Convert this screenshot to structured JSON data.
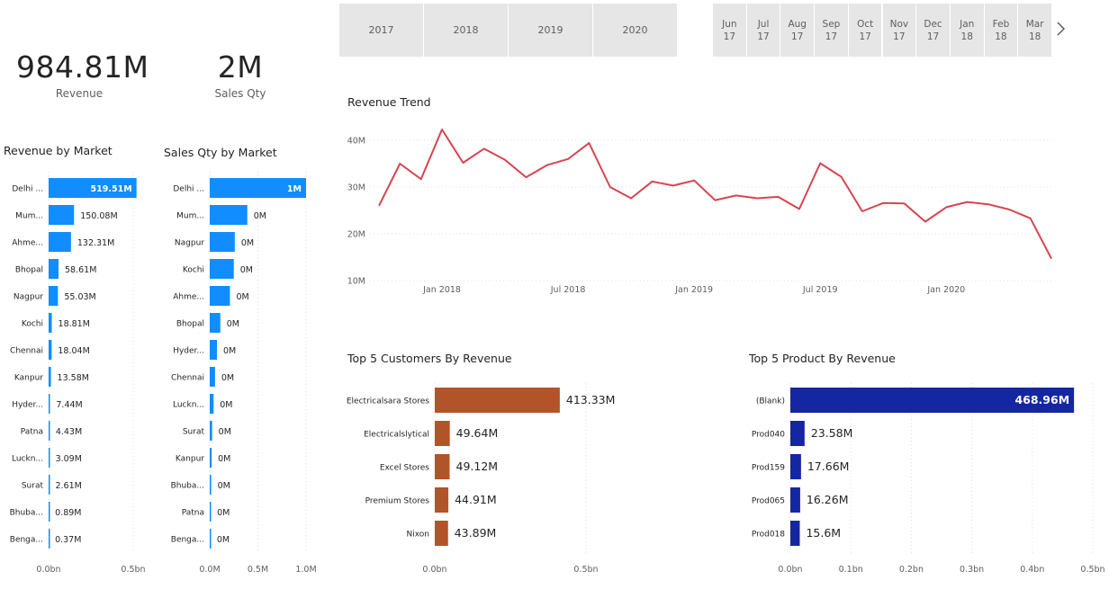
{
  "kpis": {
    "revenue": {
      "value": "984.81M",
      "label": "Revenue"
    },
    "sales_qty": {
      "value": "2M",
      "label": "Sales Qty"
    }
  },
  "year_slicer": [
    "2017",
    "2018",
    "2019",
    "2020"
  ],
  "month_slicer": [
    {
      "m": "Jun",
      "y": "17"
    },
    {
      "m": "Jul",
      "y": "17"
    },
    {
      "m": "Aug",
      "y": "17"
    },
    {
      "m": "Sep",
      "y": "17"
    },
    {
      "m": "Oct",
      "y": "17"
    },
    {
      "m": "Nov",
      "y": "17"
    },
    {
      "m": "Dec",
      "y": "17"
    },
    {
      "m": "Jan",
      "y": "18"
    },
    {
      "m": "Feb",
      "y": "18"
    },
    {
      "m": "Mar",
      "y": "18"
    }
  ],
  "colors": {
    "market_bar": "#118dff",
    "trend_line": "#d64550",
    "customer_bar": "#b3532a",
    "product_bar": "#1526a3",
    "slicer_bg": "#e6e6e6",
    "gridline": "#e1dfdd",
    "axis_text": "#605e5c"
  },
  "chart_data": [
    {
      "id": "revenue_by_market",
      "type": "bar",
      "orientation": "horizontal",
      "title": "Revenue by Market",
      "categories": [
        "Delhi ...",
        "Mum...",
        "Ahme...",
        "Bhopal",
        "Nagpur",
        "Kochi",
        "Chennai",
        "Kanpur",
        "Hyder...",
        "Patna",
        "Luckn...",
        "Surat",
        "Bhuba...",
        "Benga..."
      ],
      "values": [
        519.51,
        150.08,
        132.31,
        58.61,
        55.03,
        18.81,
        18.04,
        13.58,
        7.44,
        4.43,
        3.09,
        2.61,
        0.89,
        0.37
      ],
      "labels": [
        "519.51M",
        "150.08M",
        "132.31M",
        "58.61M",
        "55.03M",
        "18.81M",
        "18.04M",
        "13.58M",
        "7.44M",
        "4.43M",
        "3.09M",
        "2.61M",
        "0.89M",
        "0.37M"
      ],
      "unit": "M",
      "xlim": [
        0,
        500
      ],
      "xticks": [
        0,
        500
      ],
      "xtick_labels": [
        "0.0bn",
        "0.5bn"
      ],
      "grid": true
    },
    {
      "id": "sales_qty_by_market",
      "type": "bar",
      "orientation": "horizontal",
      "title": "Sales Qty by Market",
      "categories": [
        "Delhi ...",
        "Mum...",
        "Nagpur",
        "Kochi",
        "Ahme...",
        "Bhopal",
        "Hyder...",
        "Chennai",
        "Luckn...",
        "Surat",
        "Kanpur",
        "Bhuba...",
        "Patna",
        "Benga..."
      ],
      "values": [
        1.0,
        0.39,
        0.26,
        0.25,
        0.21,
        0.11,
        0.075,
        0.055,
        0.04,
        0.025,
        0.02,
        0.015,
        0.01,
        0.008
      ],
      "labels": [
        "1M",
        "0M",
        "0M",
        "0M",
        "0M",
        "0M",
        "0M",
        "0M",
        "0M",
        "0M",
        "0M",
        "0M",
        "0M",
        "0M"
      ],
      "unit": "M",
      "xlim": [
        0,
        1.0
      ],
      "xticks": [
        0,
        0.5,
        1.0
      ],
      "xtick_labels": [
        "0.0M",
        "0.5M",
        "1.0M"
      ],
      "grid": true
    },
    {
      "id": "revenue_trend",
      "type": "line",
      "title": "Revenue Trend",
      "x": [
        "2017-10",
        "2017-11",
        "2017-12",
        "2018-01",
        "2018-02",
        "2018-03",
        "2018-04",
        "2018-05",
        "2018-06",
        "2018-07",
        "2018-08",
        "2018-09",
        "2018-10",
        "2018-11",
        "2018-12",
        "2019-01",
        "2019-02",
        "2019-03",
        "2019-04",
        "2019-05",
        "2019-06",
        "2019-07",
        "2019-08",
        "2019-09",
        "2019-10",
        "2019-11",
        "2019-12",
        "2020-01",
        "2020-02",
        "2020-03",
        "2020-04",
        "2020-05",
        "2020-06"
      ],
      "series": [
        {
          "values": [
            26,
            35,
            31.7,
            42.3,
            35.2,
            38.2,
            35.8,
            32.1,
            34.7,
            36,
            39.4,
            30,
            27.6,
            31.2,
            30.3,
            31.4,
            27.2,
            28.2,
            27.6,
            27.9,
            25.3,
            35.1,
            32.2,
            24.8,
            26.6,
            26.5,
            22.6,
            25.7,
            26.8,
            26.3,
            25.2,
            23.3,
            14.7
          ]
        }
      ],
      "ylim": [
        10,
        40
      ],
      "yticks": [
        10,
        20,
        30,
        40
      ],
      "ytick_labels": [
        "10M",
        "20M",
        "30M",
        "40M"
      ],
      "xtick_labels": [
        "Jan 2018",
        "Jul 2018",
        "Jan 2019",
        "Jul 2019",
        "Jan 2020"
      ],
      "xtick_index": [
        3,
        9,
        15,
        21,
        27
      ],
      "grid": true
    },
    {
      "id": "top5_customers",
      "type": "bar",
      "orientation": "horizontal",
      "title": "Top 5 Customers By Revenue",
      "categories": [
        "Electricalsara Stores",
        "Electricalslytical",
        "Excel Stores",
        "Premium Stores",
        "Nixon"
      ],
      "values": [
        413.33,
        49.64,
        49.12,
        44.91,
        43.89
      ],
      "labels": [
        "413.33M",
        "49.64M",
        "49.12M",
        "44.91M",
        "43.89M"
      ],
      "unit": "M",
      "xlim": [
        0,
        500
      ],
      "xticks": [
        0,
        500,
        1000
      ],
      "xtick_labels": [
        "0.0bn",
        "0.5bn",
        ""
      ],
      "grid": true
    },
    {
      "id": "top5_products",
      "type": "bar",
      "orientation": "horizontal",
      "title": "Top 5 Product By Revenue",
      "categories": [
        "(Blank)",
        "Prod040",
        "Prod159",
        "Prod065",
        "Prod018"
      ],
      "values": [
        468.96,
        23.58,
        17.66,
        16.26,
        15.6
      ],
      "labels": [
        "468.96M",
        "23.58M",
        "17.66M",
        "16.26M",
        "15.6M"
      ],
      "unit": "M",
      "xlim": [
        0,
        500
      ],
      "xticks": [
        0,
        100,
        200,
        300,
        400,
        500
      ],
      "xtick_labels": [
        "0.0bn",
        "0.1bn",
        "0.2bn",
        "0.3bn",
        "0.4bn",
        "0.5bn"
      ],
      "grid": true
    }
  ]
}
